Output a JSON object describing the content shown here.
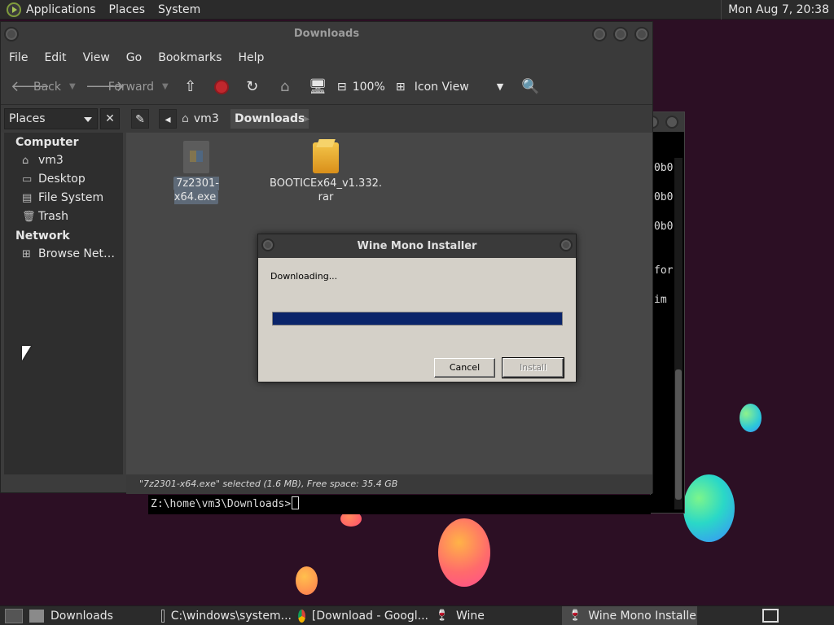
{
  "top_panel": {
    "menus": [
      "Applications",
      "Places",
      "System"
    ],
    "clock": "Mon Aug  7, 20:38"
  },
  "terminal": {
    "lines": [
      "0b0",
      "0b0",
      "0b0",
      "for",
      " im"
    ],
    "prompt": "Z:\\home\\vm3\\Downloads>"
  },
  "file_manager": {
    "title": "Downloads",
    "menu": [
      "File",
      "Edit",
      "View",
      "Go",
      "Bookmarks",
      "Help"
    ],
    "toolbar": {
      "back": "Back",
      "forward": "Forward",
      "zoom": "100%",
      "view_mode": "Icon View"
    },
    "places_combo": "Places",
    "breadcrumb": [
      "vm3",
      "Downloads"
    ],
    "sidebar": {
      "computer_heading": "Computer",
      "computer_items": [
        {
          "label": "vm3",
          "icon": "home-icon"
        },
        {
          "label": "Desktop",
          "icon": "desktop-icon"
        },
        {
          "label": "File System",
          "icon": "drive-icon"
        },
        {
          "label": "Trash",
          "icon": "trash-icon"
        }
      ],
      "network_heading": "Network",
      "network_items": [
        {
          "label": "Browse Net…",
          "icon": "network-icon"
        }
      ]
    },
    "files": [
      {
        "name": "7z2301-x64.exe",
        "selected": true
      },
      {
        "name_line1": "BOOTICEx64_v1.332.",
        "name_line2": "rar",
        "selected": false
      }
    ],
    "status": "\"7z2301-x64.exe\" selected (1.6 MB), Free space: 35.4 GB"
  },
  "dialog": {
    "title": "Wine Mono Installer",
    "message": "Downloading...",
    "progress": 1.0,
    "cancel_label": "Cancel",
    "install_label": "Install",
    "progress_color": "#0a246a"
  },
  "taskbar": {
    "items": [
      {
        "label": "Downloads",
        "icon": "folder-icon",
        "active": false
      },
      {
        "label": "C:\\windows\\system...",
        "icon": "terminal-icon",
        "active": false
      },
      {
        "label": "[Download - Googl...",
        "icon": "chrome-icon",
        "active": false
      },
      {
        "label": "Wine",
        "icon": "wine-icon",
        "active": false
      },
      {
        "label": "Wine Mono Installer",
        "icon": "wine-icon",
        "active": true
      }
    ]
  }
}
